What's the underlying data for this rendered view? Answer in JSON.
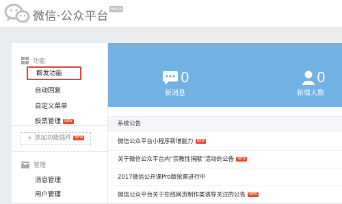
{
  "header": {
    "title": "微信·公众平台",
    "beta": "Beta",
    "logo_icon": "wechat-logo-icon"
  },
  "sidebar": {
    "section_function": {
      "label": "功能",
      "icon": "grid-icon"
    },
    "items": [
      {
        "label": "群发功能"
      },
      {
        "label": "自动回复"
      },
      {
        "label": "自定义菜单"
      },
      {
        "label": "投票管理",
        "badge": "NEW"
      }
    ],
    "add_plugin": {
      "label": "添加功能插件",
      "badge": "NEW"
    },
    "section_manage": {
      "label": "管理",
      "icon": "mail-icon"
    },
    "manage_items": [
      {
        "label": "消息管理"
      },
      {
        "label": "用户管理"
      }
    ]
  },
  "stats": [
    {
      "value": "0",
      "label": "新消息",
      "icon": "message-icon"
    },
    {
      "value": "0",
      "label": "新增人数",
      "icon": "user-icon"
    }
  ],
  "notices": {
    "heading": "系统公告",
    "items": [
      {
        "title": "微信公众平台小程序新增能力",
        "badge": "NEW"
      },
      {
        "title": "关于微信公众平台内“宗教性捐献”活动的公告",
        "badge": "NEW"
      },
      {
        "title": "2017微信公开课Pro版抢票进行中"
      },
      {
        "title": "微信公众平台关于在线网页制作类诱导关注的公告",
        "badge": "NEW"
      }
    ]
  },
  "colors": {
    "stats_bg": "#72b1e4",
    "selection_border": "#e53935",
    "new_badge": "#e44a2a"
  }
}
